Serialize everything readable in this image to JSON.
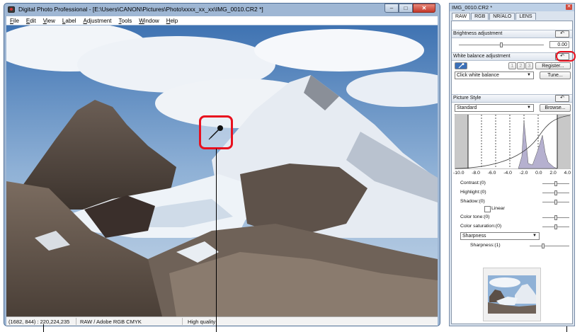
{
  "main_window": {
    "title": "Digital Photo Professional - [E:\\Users\\CANON\\Pictures\\Photo\\xxxx_xx_xx\\IMG_0010.CR2 *]",
    "menu": [
      "File",
      "Edit",
      "View",
      "Label",
      "Adjustment",
      "Tools",
      "Window",
      "Help"
    ],
    "window_buttons": {
      "minimize": "–",
      "maximize": "□",
      "close": "✕"
    },
    "status": {
      "coords": "(1682, 844) : 220,224,235",
      "format": "RAW / Adobe RGB  CMYK",
      "quality": "High quality"
    }
  },
  "tool_palette": {
    "title": "IMG_0010.CR2 *",
    "close": "✕",
    "tabs": [
      "RAW",
      "RGB",
      "NR/ALO",
      "LENS"
    ],
    "brightness": {
      "label": "Brightness adjustment",
      "value": "0.00",
      "reset": "↶"
    },
    "white_balance": {
      "label": "White balance adjustment",
      "reset": "↶",
      "slots": [
        "1",
        "2",
        "3"
      ],
      "register": "Register...",
      "mode": "Click white balance",
      "tune": "Tune..."
    },
    "picture_style": {
      "label": "Picture Style",
      "reset": "↶",
      "value": "Standard",
      "browse": "Browse...",
      "axis_ticks": [
        "-10.0",
        "-8.0",
        "-6.0",
        "-4.0",
        "-2.0",
        "0.0",
        "2.0",
        "4.0"
      ],
      "contrast": "Contrast:(0)",
      "highlight": "Highlight:(0)",
      "shadow": "Shadow:(0)",
      "linear": "Linear",
      "color_tone": "Color tone:(0)",
      "color_saturation": "Color saturation:(0)",
      "sharpness_mode": "Sharpness",
      "sharpness": "Sharpness:(1)"
    }
  }
}
